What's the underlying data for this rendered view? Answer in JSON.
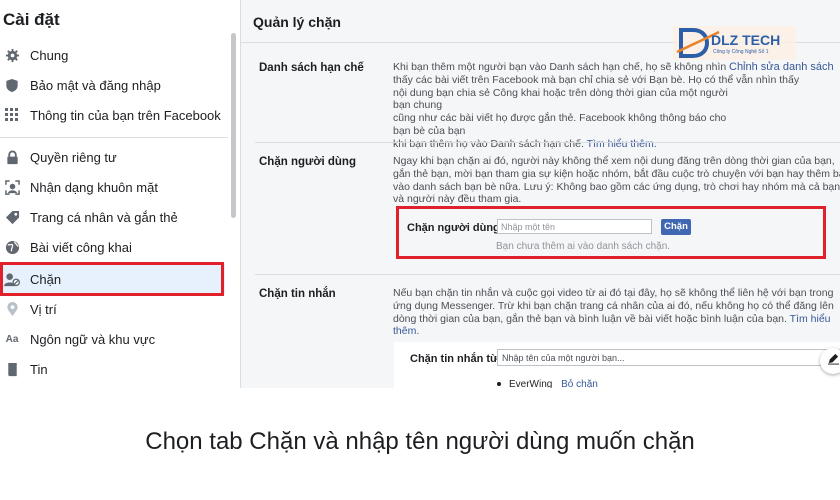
{
  "sidebar": {
    "title": "Cài đặt",
    "items": [
      {
        "label": "Chung",
        "icon": "gear-icon"
      },
      {
        "label": "Bảo mật và đăng nhập",
        "icon": "shield-icon"
      },
      {
        "label": "Thông tin của bạn trên Facebook",
        "icon": "grid-icon"
      },
      {
        "label": "Quyền riêng tư",
        "icon": "lock-icon"
      },
      {
        "label": "Nhận dạng khuôn mặt",
        "icon": "face-icon"
      },
      {
        "label": "Trang cá nhân và gắn thẻ",
        "icon": "tag-icon"
      },
      {
        "label": "Bài viết công khai",
        "icon": "globe-icon"
      },
      {
        "label": "Chặn",
        "icon": "block-user-icon"
      },
      {
        "label": "Vị trí",
        "icon": "location-pin-icon"
      },
      {
        "label": "Ngôn ngữ và khu vực",
        "icon": "language-icon"
      },
      {
        "label": "Tin",
        "icon": "book-icon"
      }
    ]
  },
  "main": {
    "title": "Quản lý chặn",
    "logo_text": "DLZ TECH",
    "logo_sub": "Công ty Công Nghệ Số 1",
    "restricted": {
      "label": "Danh sách hạn chế",
      "edit_link": "Chỉnh sửa danh sách",
      "lines": [
        "Khi bạn thêm một người bạn vào Danh sách hạn chế, họ sẽ không nhìn",
        "thấy các bài viết trên Facebook mà bạn chỉ chia sẻ với Bạn bè. Họ có thể vẫn nhìn thấy",
        "nội dung bạn chia sẻ Công khai hoặc trên dòng thời gian của một người bạn chung",
        "cũng như các bài viết họ được gắn thẻ. Facebook không thông báo cho bạn bè của bạn"
      ],
      "last_line": "khi bạn thêm họ vào Danh sách hạn chế.",
      "learn_more": "Tìm hiểu thêm."
    },
    "block_users": {
      "label": "Chặn người dùng",
      "lines": [
        "Ngay khi bạn chặn ai đó, người này không thể xem nội dung đăng trên dòng thời gian của bạn,",
        "gắn thẻ bạn, mời bạn tham gia sự kiện hoặc nhóm, bắt đầu cuộc trò chuyện với bạn hay thêm bạn",
        "vào danh sách bạn bè nữa. Lưu ý: Không bao gồm các ứng dụng, trò chơi hay nhóm mà cả bạn",
        "và người này đều tham gia."
      ],
      "field_label": "Chặn người dùng",
      "placeholder": "Nhập một tên",
      "button": "Chặn",
      "empty_text": "Bạn chưa thêm ai vào danh sách chặn."
    },
    "block_messages": {
      "label": "Chặn tin nhắn",
      "lines": [
        "Nếu bạn chặn tin nhắn và cuộc gọi video từ ai đó tại đây, họ sẽ không thể liên hệ với bạn trong",
        "ứng dụng Messenger. Trừ khi bạn chặn trang cá nhân của ai đó, nếu không họ có thể đăng lên",
        "dòng thời gian của bạn, gắn thẻ bạn và bình luận về bài viết hoặc bình luận của bạn."
      ],
      "learn_more_a": "Tìm hiểu",
      "learn_more_b": "thêm.",
      "field_label": "Chặn tin nhắn từ",
      "placeholder": "Nhập tên của một người bạn...",
      "blocked_name": "EverWing",
      "unblock": "Bỏ chặn"
    }
  },
  "caption": "Chọn tab Chặn và nhập tên người dùng muốn chặn",
  "colors": {
    "highlight": "#e0202a",
    "link": "#385898",
    "button": "#4267b2",
    "logo": "#2c5fa8"
  }
}
